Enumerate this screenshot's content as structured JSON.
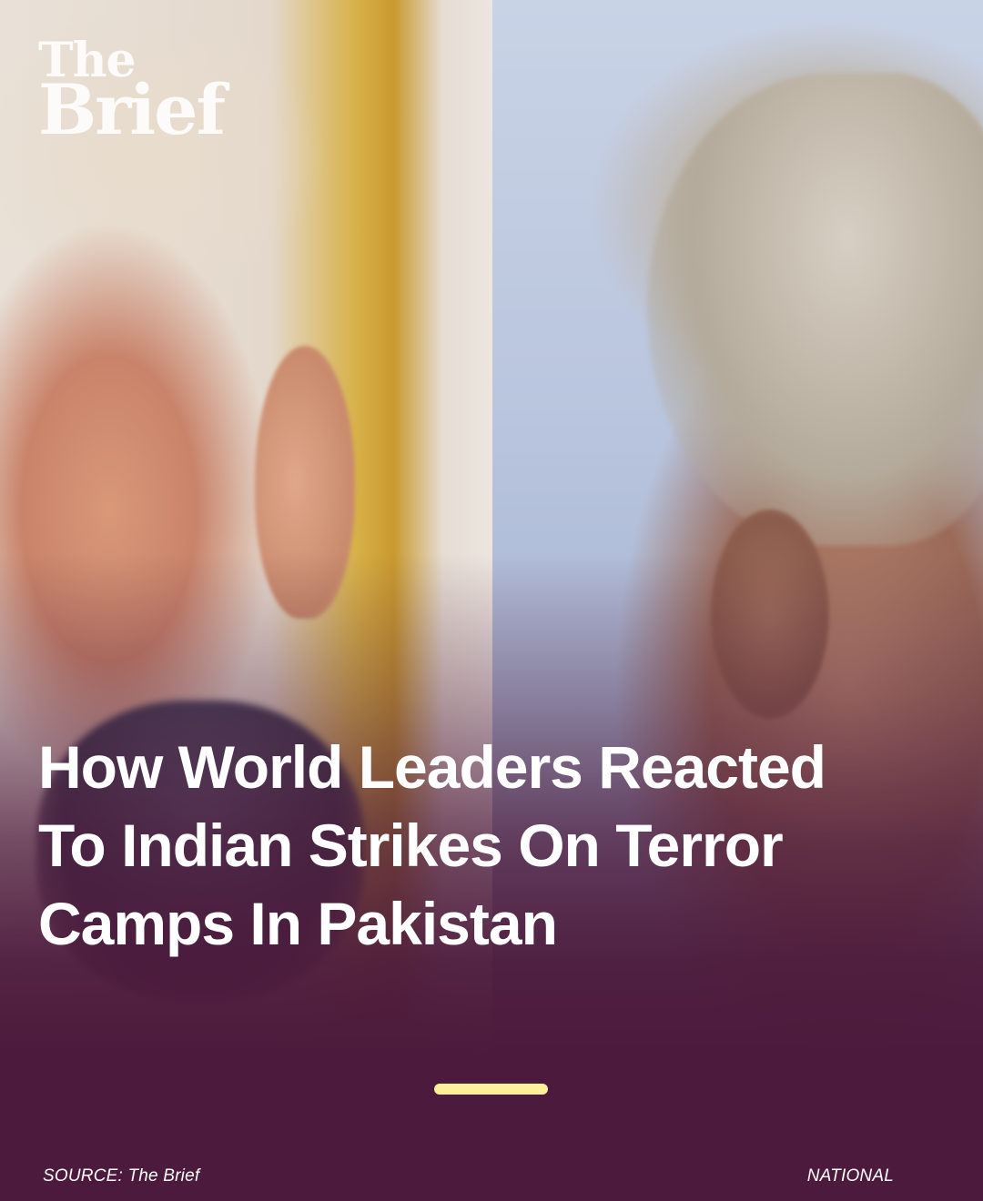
{
  "logo": {
    "line1": "The",
    "line2": "Brief"
  },
  "headline": {
    "line1": "How World Leaders Reacted",
    "line2": "To Indian Strikes On Terror",
    "line3": "Camps In Pakistan"
  },
  "footer": {
    "source": "SOURCE: The Brief",
    "category": "NATIONAL"
  },
  "colors": {
    "background": "#4c1a3c",
    "indicator": "#fdf09a",
    "text": "#ffffff"
  }
}
